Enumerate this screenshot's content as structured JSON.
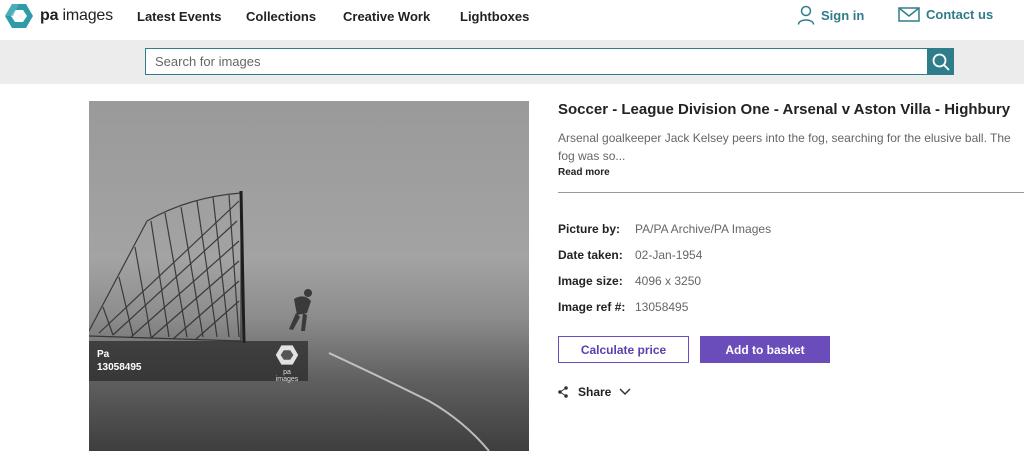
{
  "brand": {
    "logo_bold": "pa",
    "logo_rest": " images",
    "accent": "#2f7d8b",
    "button_color": "#6a4dbb"
  },
  "nav": {
    "items": [
      {
        "label": "Latest Events"
      },
      {
        "label": "Collections"
      },
      {
        "label": "Creative Work"
      },
      {
        "label": "Lightboxes"
      }
    ]
  },
  "header_right": {
    "sign_in": {
      "label": "Sign in",
      "icon": "user-icon"
    },
    "contact": {
      "label": "Contact us",
      "icon": "envelope-icon"
    }
  },
  "search": {
    "placeholder": "Search for images",
    "value": "",
    "icon": "search-icon"
  },
  "image": {
    "watermark_line1": "Pa",
    "watermark_line2": "13058495",
    "watermark_logo_label": "pa images"
  },
  "detail": {
    "title": "Soccer - League Division One - Arsenal v Aston Villa - Highbury",
    "description": "Arsenal goalkeeper Jack Kelsey peers into the fog, searching for the elusive ball. The fog was so...",
    "read_more": "Read more",
    "meta": [
      {
        "label": "Picture by:",
        "value": "PA/PA Archive/PA Images"
      },
      {
        "label": "Date taken:",
        "value": "02-Jan-1954"
      },
      {
        "label": "Image size:",
        "value": "4096 x 3250"
      },
      {
        "label": "Image ref #:",
        "value": "13058495"
      }
    ],
    "calculate_label": "Calculate price",
    "basket_label": "Add to basket",
    "share_label": "Share"
  }
}
